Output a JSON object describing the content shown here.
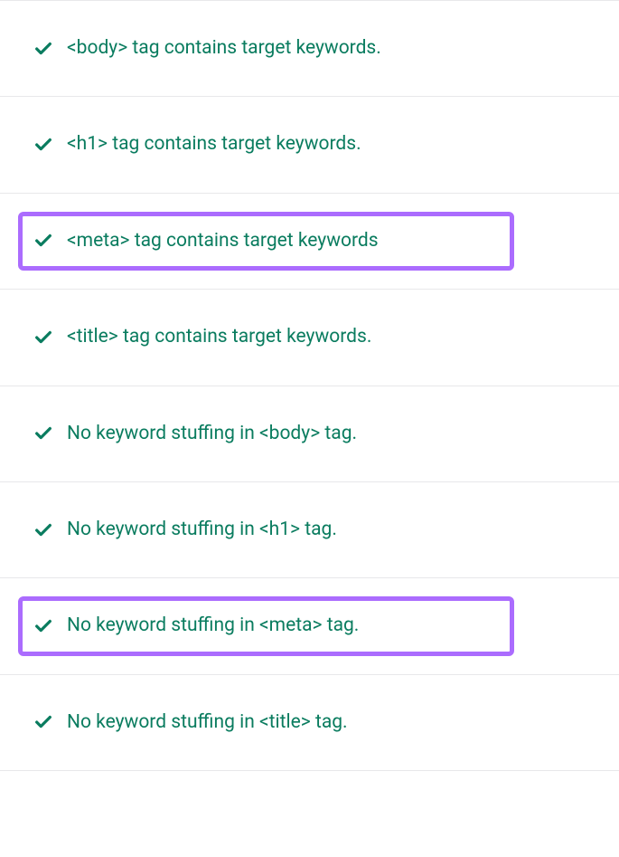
{
  "checklist": {
    "items": [
      {
        "text": "<body> tag contains target keywords.",
        "highlighted": false
      },
      {
        "text": "<h1> tag contains target keywords.",
        "highlighted": false
      },
      {
        "text": "<meta> tag contains target keywords",
        "highlighted": true
      },
      {
        "text": "<title> tag contains target keywords.",
        "highlighted": false
      },
      {
        "text": "No keyword stuffing in <body> tag.",
        "highlighted": false
      },
      {
        "text": "No keyword stuffing in <h1> tag.",
        "highlighted": false
      },
      {
        "text": "No keyword stuffing in <meta> tag.",
        "highlighted": true
      },
      {
        "text": "No keyword stuffing in <title> tag.",
        "highlighted": false
      }
    ]
  },
  "colors": {
    "success": "#0a7c5f",
    "highlight": "#ab6cfe",
    "border": "#e8e8ea"
  }
}
